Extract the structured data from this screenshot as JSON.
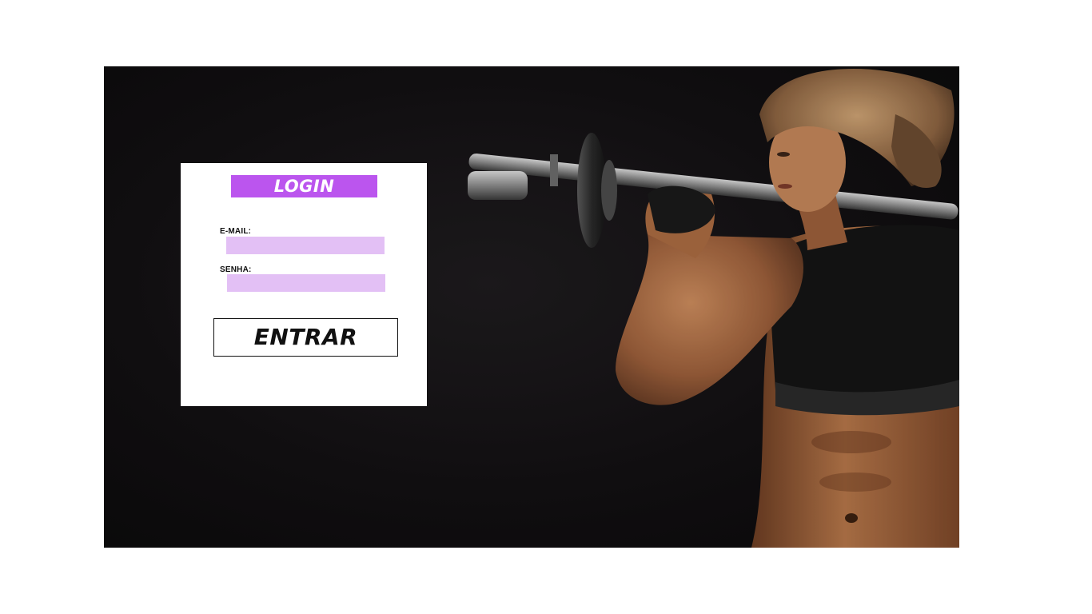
{
  "login": {
    "title": "LOGIN",
    "email_label": "E-MAIL:",
    "email_value": "",
    "password_label": "SENHA:",
    "password_value": "",
    "submit_label": "ENTRAR"
  },
  "hero": {
    "image": "fitness-woman-barbell-photo"
  },
  "colors": {
    "accent": "#bb55ee",
    "input_fill": "#e3c0f5",
    "backdrop": "#121012"
  }
}
